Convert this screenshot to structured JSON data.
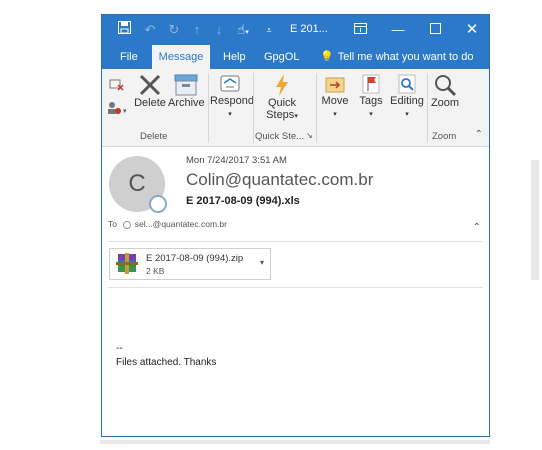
{
  "titlebar": {
    "title": "E 201...",
    "icons": [
      "save-icon",
      "undo-icon",
      "redo-icon",
      "up-arrow-icon",
      "down-arrow-icon",
      "touch-mode-icon",
      "customize-qat-icon",
      "ribbon-display-icon",
      "minimize-icon",
      "maximize-icon",
      "close-icon"
    ]
  },
  "tabs": [
    "File",
    "Message",
    "Help",
    "GpgOL"
  ],
  "active_tab": "Message",
  "tell_me": "Tell me what you want to do",
  "ribbon": {
    "delete_group": {
      "ignore": "",
      "delete": "Delete",
      "archive": "Archive",
      "label": "Delete"
    },
    "respond": "Respond",
    "quick_steps": {
      "line1": "Quick",
      "line2": "Steps",
      "label": "Quick Ste..."
    },
    "move": "Move",
    "tags": "Tags",
    "editing": "Editing",
    "zoom": {
      "button": "Zoom",
      "label": "Zoom"
    }
  },
  "message": {
    "avatar_initial": "C",
    "date": "Mon 7/24/2017 3:51 AM",
    "from": "Colin@quantatec.com.br",
    "subject": "E 2017-08-09 (994).xls",
    "to_label": "To",
    "to_value": "sel...@quantatec.com.br"
  },
  "attachment": {
    "name": "E 2017-08-09 (994).zip",
    "size": "2 KB"
  },
  "body": {
    "line1": "--",
    "line2": "Files attached. Thanks"
  },
  "colors": {
    "accent": "#2b79c8",
    "ribbon_bg": "#f3f3f3",
    "quick_steps_bolt": "#f0a830",
    "tags_flag": "#d9412b"
  }
}
